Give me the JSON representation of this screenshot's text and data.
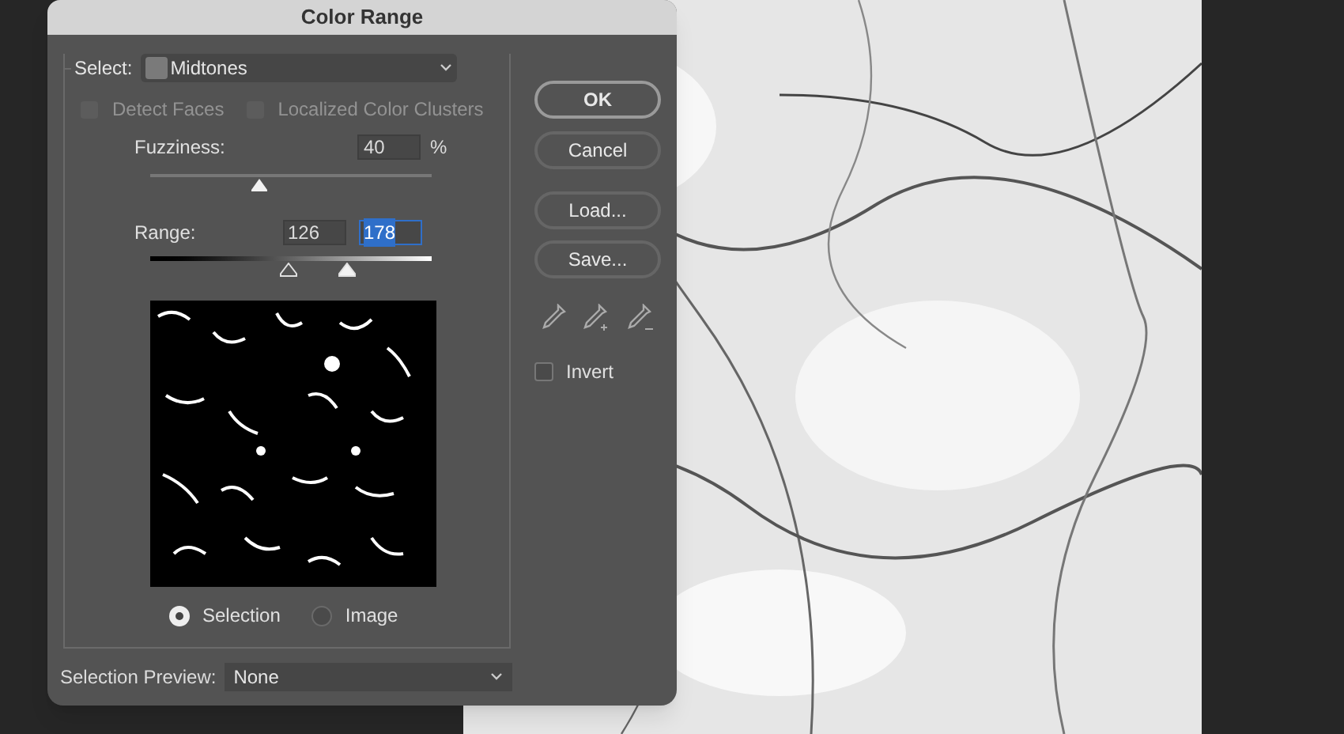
{
  "window": {
    "title": "Color Range"
  },
  "select": {
    "label": "Select:",
    "value": "Midtones"
  },
  "options": [
    {
      "label": "Detect Faces",
      "checked": false,
      "disabled": true
    },
    {
      "label": "Localized Color Clusters",
      "checked": false,
      "disabled": true
    }
  ],
  "fuzziness": {
    "label": "Fuzziness:",
    "value": "40",
    "unit": "%",
    "level": 0.39
  },
  "range": {
    "label": "Range:",
    "fields": [
      {
        "value": "126",
        "selected": false
      },
      {
        "value": "178",
        "selected": true
      }
    ],
    "thumbs": [
      {
        "level": 0.49
      },
      {
        "level": 0.7
      }
    ]
  },
  "preview_modes": [
    {
      "label": "Selection",
      "selected": true
    },
    {
      "label": "Image",
      "selected": false
    }
  ],
  "buttons": [
    {
      "label": "OK",
      "default": true
    },
    {
      "label": "Cancel",
      "default": false
    },
    {
      "label": "Load...",
      "default": false
    },
    {
      "label": "Save...",
      "default": false
    }
  ],
  "invert": {
    "label": "Invert",
    "checked": false
  },
  "selection_preview": {
    "label": "Selection Preview:",
    "value": "None"
  }
}
